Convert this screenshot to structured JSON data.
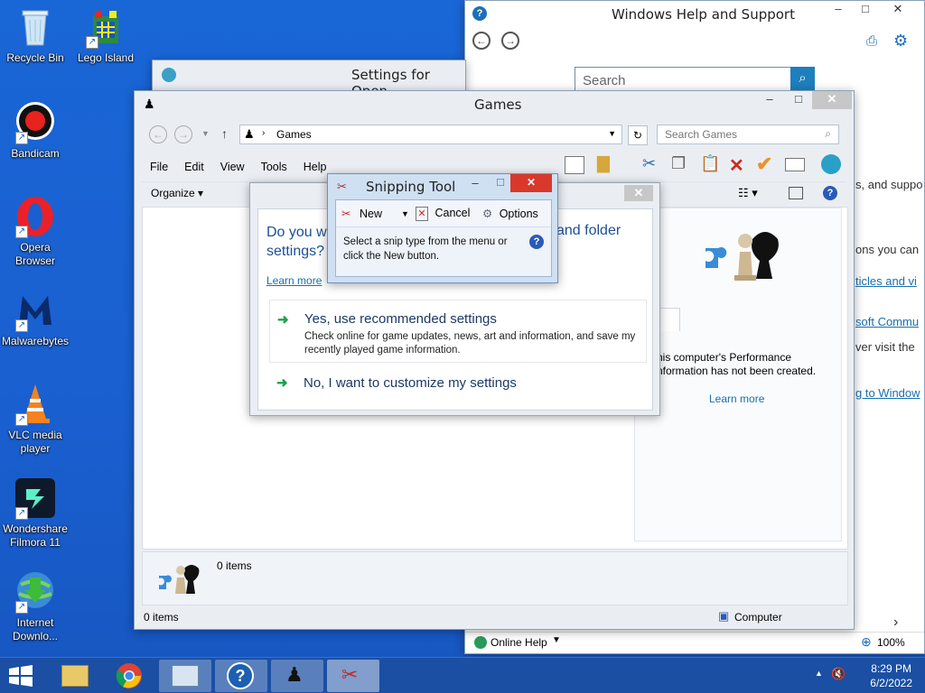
{
  "desktop": {
    "icons": [
      {
        "label": "Recycle Bin"
      },
      {
        "label": "Lego Island"
      },
      {
        "label": "Bandicam"
      },
      {
        "label": "Opera Browser"
      },
      {
        "label": "Malwarebytes"
      },
      {
        "label": "VLC media player"
      },
      {
        "label": "Wondershare Filmora 11"
      },
      {
        "label": "Internet Downlo..."
      }
    ]
  },
  "help_window": {
    "title": "Windows Help and Support",
    "search_placeholder": "Search",
    "side_texts": [
      "s, and suppo",
      "ons you can",
      "ticles and vi",
      "soft Commu",
      "ver visit the",
      "g to Window"
    ],
    "online_help": "Online Help",
    "zoom": "100%"
  },
  "settings_window": {
    "title": "Settings for Open-"
  },
  "games_window": {
    "title": "Games",
    "address": "Games",
    "search_placeholder": "Search Games",
    "menu": [
      "File",
      "Edit",
      "View",
      "Tools",
      "Help"
    ],
    "organize": "Organize",
    "perf_text": "his computer's Performance nformation has not been created.",
    "learn_more": "Learn more",
    "details_count": "0 items",
    "status_count": "0 items",
    "status_location": "Computer"
  },
  "dialog": {
    "question_part1": "Do you wa",
    "question_line2": "settings?",
    "question_part2": "and folder",
    "learn_more": "Learn more",
    "option1_title": "Yes, use recommended settings",
    "option1_desc": "Check online for game updates, news, art and information, and save my recently played game information.",
    "option2_title": "No, I want to customize my settings"
  },
  "snipping_tool": {
    "title": "Snipping Tool",
    "new_label": "New",
    "cancel_label": "Cancel",
    "options_label": "Options",
    "message": "Select a snip type from the menu or click the New button."
  },
  "taskbar": {
    "time": "8:29 PM",
    "date": "6/2/2022"
  }
}
